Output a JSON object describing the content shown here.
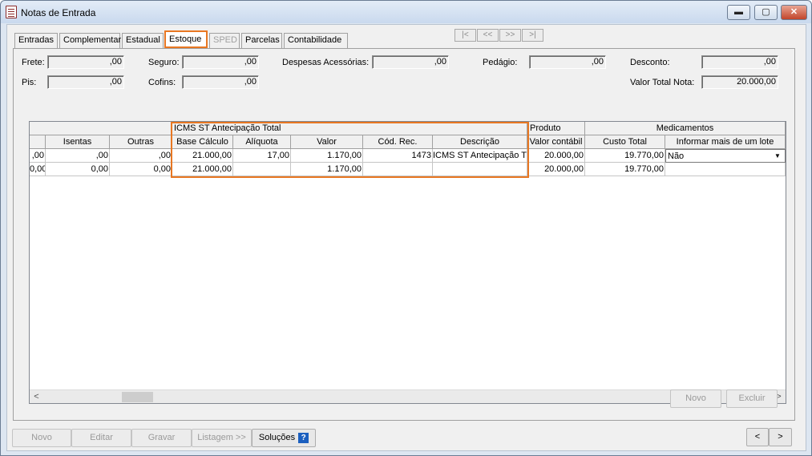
{
  "window": {
    "title": "Notas de Entrada",
    "icon": "document-icon",
    "controls": {
      "minimize": "▬",
      "maximize": "▢",
      "close": "✕"
    }
  },
  "tabs": [
    {
      "label": "Entradas",
      "state": "normal"
    },
    {
      "label": "Complementar",
      "state": "normal"
    },
    {
      "label": "Estadual",
      "state": "normal"
    },
    {
      "label": "Estoque",
      "state": "active"
    },
    {
      "label": "SPED",
      "state": "disabled"
    },
    {
      "label": "Parcelas",
      "state": "normal"
    },
    {
      "label": "Contabilidade",
      "state": "normal"
    }
  ],
  "record_nav": {
    "first": "|<",
    "prev": "<<",
    "next": ">>",
    "last": ">|"
  },
  "fields": {
    "frete": {
      "label": "Frete:",
      "value": ",00"
    },
    "seguro": {
      "label": "Seguro:",
      "value": ",00"
    },
    "despesas": {
      "label": "Despesas Acessórias:",
      "value": ",00"
    },
    "pedagio": {
      "label": "Pedágio:",
      "value": ",00"
    },
    "desconto": {
      "label": "Desconto:",
      "value": ",00"
    },
    "pis": {
      "label": "Pis:",
      "value": ",00"
    },
    "cofins": {
      "label": "Cofins:",
      "value": ",00"
    },
    "valor_total": {
      "label": "Valor Total Nota:",
      "value": "20.000,00"
    }
  },
  "grid": {
    "groups": {
      "icms": "ICMS ST Antecipação Total",
      "produto": "Produto",
      "medicamentos": "Medicamentos"
    },
    "columns": {
      "isentas": "Isentas",
      "outras": "Outras",
      "base": "Base Cálculo",
      "aliquota": "Alíquota",
      "valor": "Valor",
      "cod": "Cód. Rec.",
      "desc": "Descrição",
      "vcontabil": "Valor contábil",
      "custo": "Custo Total",
      "lote": "Informar mais de um lote"
    },
    "row1": {
      "c0": ",00",
      "isentas": ",00",
      "outras": ",00",
      "base": "21.000,00",
      "aliquota": "17,00",
      "valor": "1.170,00",
      "cod": "1473",
      "desc": "ICMS ST Antecipação T",
      "vcontabil": "20.000,00",
      "custo": "19.770,00",
      "lote": "Não"
    },
    "totals": {
      "c0": "0,00",
      "isentas": "0,00",
      "outras": "0,00",
      "base": "21.000,00",
      "aliquota": "",
      "valor": "1.170,00",
      "cod": "",
      "desc": "",
      "vcontabil": "20.000,00",
      "custo": "19.770,00",
      "lote": ""
    },
    "scroll": {
      "left": "<",
      "right": ">"
    }
  },
  "panel_buttons": {
    "novo": "Novo",
    "excluir": "Excluir"
  },
  "footer": {
    "novo": "Novo",
    "editar": "Editar",
    "gravar": "Gravar",
    "listagem": "Listagem >>",
    "solucoes": "Soluções",
    "help": "?",
    "prev": "<",
    "next": ">"
  }
}
